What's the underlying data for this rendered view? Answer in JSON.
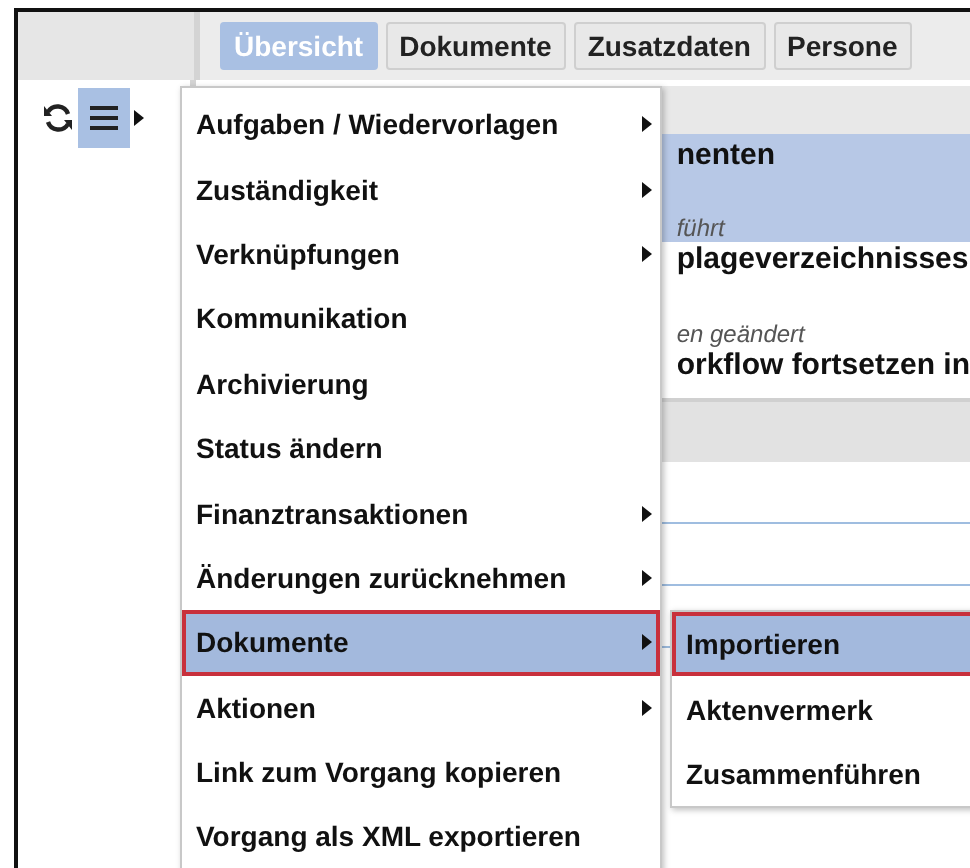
{
  "tabs": [
    {
      "label": "Übersicht",
      "selected": true
    },
    {
      "label": "Dokumente",
      "selected": false
    },
    {
      "label": "Zusatzdaten",
      "selected": false
    },
    {
      "label": "Persone",
      "selected": false
    }
  ],
  "background_content": {
    "lines": [
      {
        "text": "nenten",
        "kind": "title"
      },
      {
        "text": "führt",
        "kind": "meta"
      },
      {
        "text": "plageverzeichnisses",
        "kind": "title"
      },
      {
        "text": "en geändert",
        "kind": "meta"
      },
      {
        "text": "orkflow fortsetzen in",
        "kind": "title"
      }
    ]
  },
  "context_menu": {
    "items": [
      {
        "label": "Aufgaben / Wiedervorlagen",
        "has_submenu": true,
        "selected": false
      },
      {
        "label": "Zuständigkeit",
        "has_submenu": true,
        "selected": false
      },
      {
        "label": "Verknüpfungen",
        "has_submenu": true,
        "selected": false
      },
      {
        "label": "Kommunikation",
        "has_submenu": false,
        "selected": false
      },
      {
        "label": "Archivierung",
        "has_submenu": false,
        "selected": false
      },
      {
        "label": "Status ändern",
        "has_submenu": false,
        "selected": false
      },
      {
        "label": "Finanztransaktionen",
        "has_submenu": true,
        "selected": false
      },
      {
        "label": "Änderungen zurücknehmen",
        "has_submenu": true,
        "selected": false
      },
      {
        "label": "Dokumente",
        "has_submenu": true,
        "selected": true
      },
      {
        "label": "Aktionen",
        "has_submenu": true,
        "selected": false
      },
      {
        "label": "Link zum Vorgang kopieren",
        "has_submenu": false,
        "selected": false
      },
      {
        "label": "Vorgang als XML exportieren",
        "has_submenu": false,
        "selected": false
      }
    ]
  },
  "submenu": {
    "items": [
      {
        "label": "Importieren",
        "selected": true
      },
      {
        "label": "Aktenvermerk",
        "selected": false
      },
      {
        "label": "Zusammenführen",
        "selected": false
      }
    ]
  }
}
